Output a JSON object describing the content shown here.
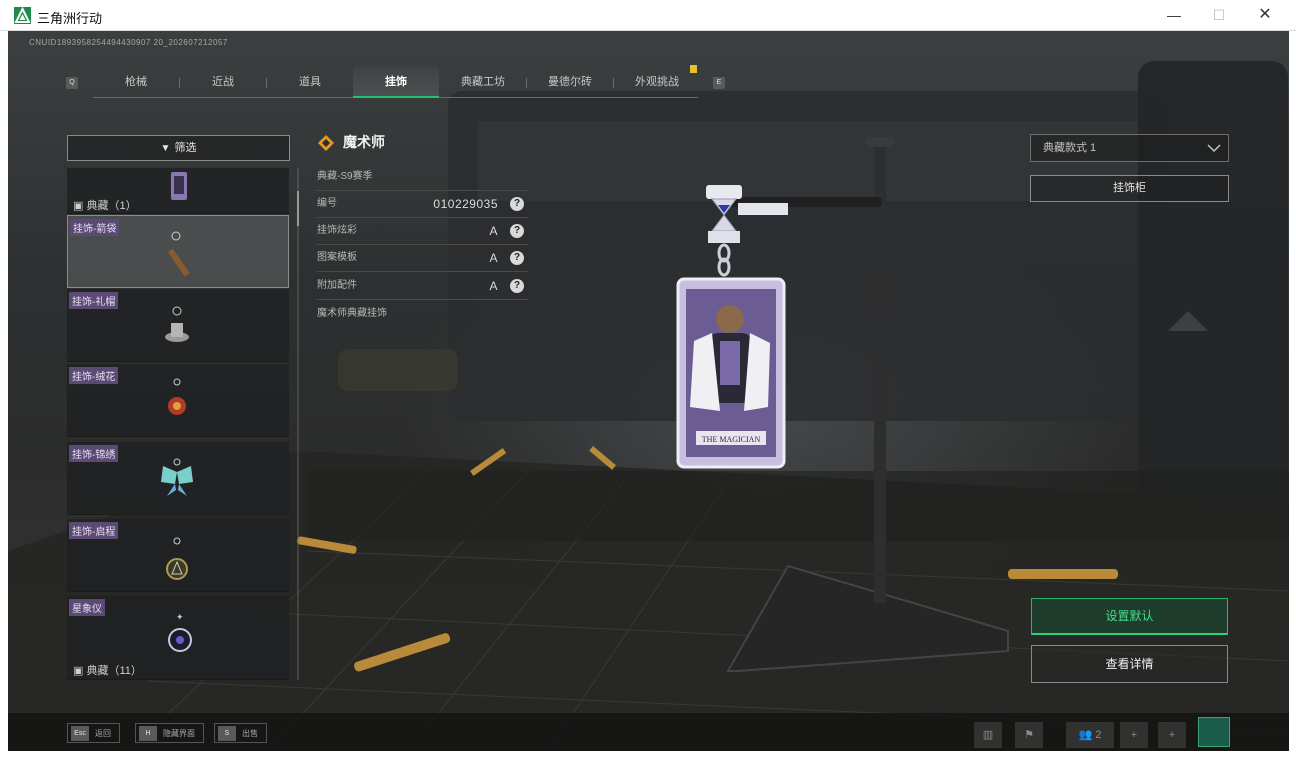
{
  "window": {
    "title": "三角洲行动",
    "controls": [
      "—",
      "☐",
      "✕"
    ]
  },
  "game": {
    "uid": "CNUID1893958254494430907 20_202607212057",
    "tabs": [
      "枪械",
      "近战",
      "道具",
      "挂饰",
      "典藏工坊",
      "曼德尔砖",
      "外观挑战"
    ],
    "active_tab": "挂饰",
    "tab_prev_key": "Q",
    "tab_next_key": "E",
    "filter_label": "筛选",
    "list": {
      "top_section": "典藏（1）",
      "items": [
        {
          "tag": "挂饰-箭袋",
          "selected": true
        },
        {
          "tag": "挂饰-礼帽",
          "selected": false
        },
        {
          "tag": "挂饰-绒花",
          "selected": false
        },
        {
          "tag": "挂饰-锦绣",
          "selected": false
        },
        {
          "tag": "挂饰-启程",
          "selected": false
        },
        {
          "tag": "星象仪",
          "selected": false
        }
      ],
      "bottom_section": "典藏（11）"
    },
    "detail": {
      "name": "魔术师",
      "season": "典藏-S9赛季",
      "rows": [
        {
          "label": "编号",
          "value": "010229035"
        },
        {
          "label": "挂饰炫彩",
          "value": "A"
        },
        {
          "label": "图案模板",
          "value": "A"
        },
        {
          "label": "附加配件",
          "value": "A"
        }
      ],
      "description": "魔术师典藏挂饰",
      "card_caption": "THE MAGICIAN"
    },
    "right_panel": {
      "style_select": "典藏款式 1",
      "rack_button": "挂饰柜",
      "default_button": "设置默认",
      "details_button": "查看详情"
    },
    "bottom_bar": {
      "hints": [
        {
          "key": "Esc",
          "label": "返回"
        },
        {
          "key": "H",
          "label": "隐藏界面"
        },
        {
          "key": "S",
          "label": "出售"
        }
      ],
      "party_count": "2"
    },
    "colors": {
      "accent_green": "#2bd278",
      "tag_purple": "#5a4a74",
      "notification": "#e6c030"
    }
  }
}
